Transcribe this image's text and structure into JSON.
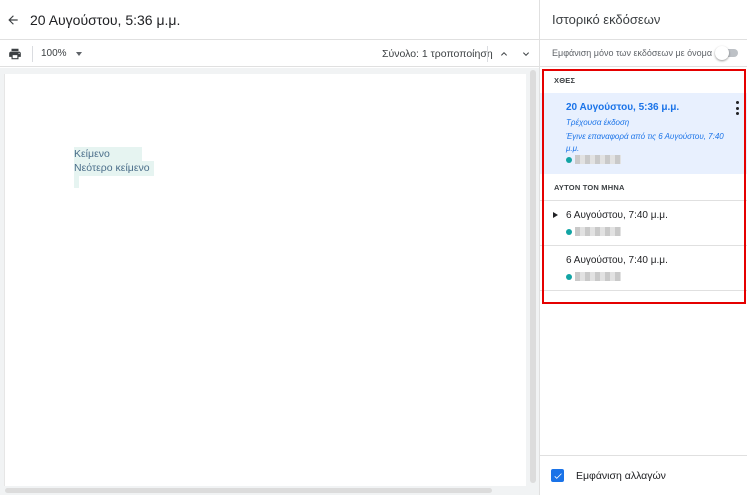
{
  "header": {
    "doc_title": "20 Αυγούστου, 5:36 μ.μ.",
    "back_icon": "arrow-left-icon"
  },
  "toolbar": {
    "print_icon": "print-icon",
    "zoom": "100%",
    "total_changes": "Σύνολο: 1 τροποποίηση",
    "prev_icon": "chevron-up-icon",
    "next_icon": "chevron-down-icon"
  },
  "document": {
    "lines": [
      "Κείμενο",
      "Νεότερο κείμενο"
    ]
  },
  "panel": {
    "title": "Ιστορικό εκδόσεων",
    "named_only_label": "Εμφάνιση μόνο των εκδόσεων με όνομα",
    "named_only_on": false,
    "sections": [
      {
        "heading": "ΧΘΕΣ",
        "versions": [
          {
            "date": "20 Αυγούστου, 5:36 μ.μ.",
            "status": "Τρέχουσα έκδοση",
            "restore_note": "Έγινε επαναφορά από τις 6 Αυγούστου, 7:40 μ.μ.",
            "current": true
          }
        ]
      },
      {
        "heading": "ΑΥΤΟΝ ΤΟΝ ΜΗΝΑ",
        "versions": [
          {
            "date": "6 Αυγούστου, 7:40 μ.μ.",
            "expandable": true
          },
          {
            "date": "6 Αυγούστου, 7:40 μ.μ.",
            "expandable": false
          }
        ]
      }
    ],
    "footer": {
      "show_changes_label": "Εμφάνιση αλλαγών",
      "show_changes_checked": true
    }
  },
  "colors": {
    "accent": "#1a73e8",
    "current_bg": "#e8f0fe",
    "highlight_border": "#e50000",
    "user_dot": "#12a4a4",
    "inserted_text_bg": "#e6f4f1"
  }
}
